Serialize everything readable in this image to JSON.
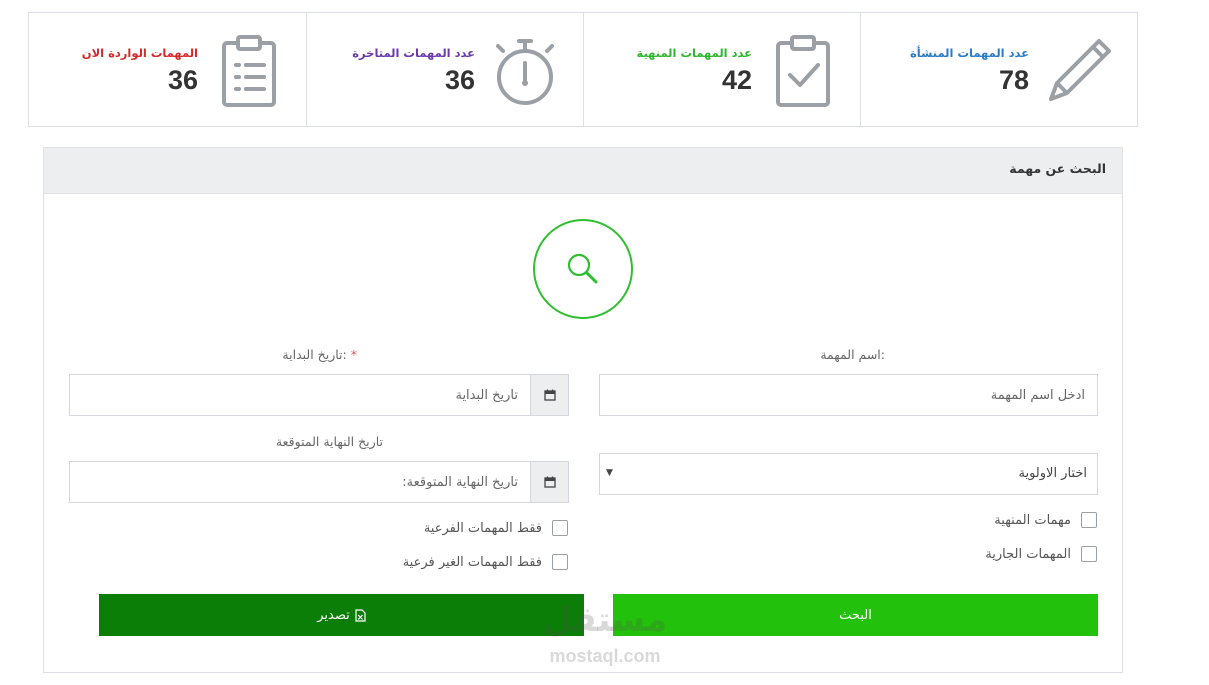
{
  "stats": [
    {
      "label": "عدد المهمات المنشأة",
      "value": "78",
      "color": "#2a7bc7",
      "icon": "pencil-icon"
    },
    {
      "label": "عدد المهمات المنهية",
      "value": "42",
      "color": "#2fb52f",
      "icon": "clipboard-check-icon"
    },
    {
      "label": "عدد المهمات المتاخرة",
      "value": "36",
      "color": "#6a3aa8",
      "icon": "stopwatch-icon"
    },
    {
      "label": "المهمات الواردة الان",
      "value": "36",
      "color": "#d42a2a",
      "icon": "clipboard-list-icon"
    }
  ],
  "panel": {
    "title": "البحث عن مهمة"
  },
  "form": {
    "task_name_label": "اسم المهمة:",
    "task_name_placeholder": "ادخل اسم المهمة",
    "start_date_label": "تاريخ البداية:",
    "start_date_required": "*",
    "start_date_placeholder": "تاريخ البداية",
    "end_date_label": "تاريخ النهاية المتوقعة",
    "end_date_placeholder": "تاريخ النهاية المتوقعة:",
    "priority_selected": "اختار الاولوية",
    "checkboxes": {
      "finished": "مهمات المنهية",
      "ongoing": "المهمات الجارية",
      "subtasks_only": "فقط المهمات الفرعية",
      "non_subtasks_only": "فقط المهمات الغير فرعية"
    },
    "search_button": "البحث",
    "export_button": "تصدير"
  },
  "watermark": {
    "arabic": "مستقل",
    "latin": "mostaql.com"
  }
}
